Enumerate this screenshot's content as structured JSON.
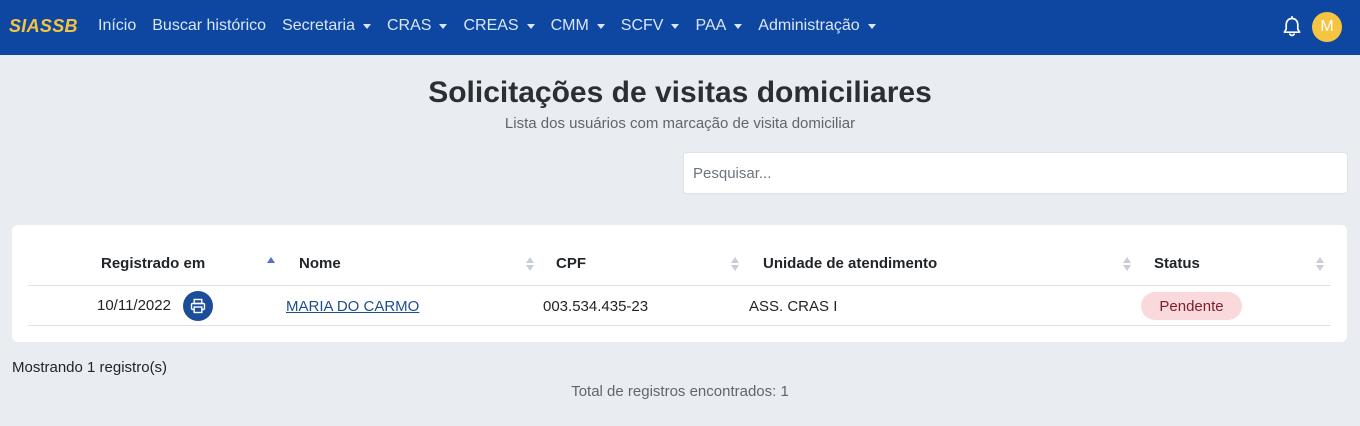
{
  "navbar": {
    "brand": "SIASSB",
    "items": [
      {
        "label": "Início",
        "dropdown": false
      },
      {
        "label": "Buscar histórico",
        "dropdown": false
      },
      {
        "label": "Secretaria",
        "dropdown": true
      },
      {
        "label": "CRAS",
        "dropdown": true
      },
      {
        "label": "CREAS",
        "dropdown": true
      },
      {
        "label": "CMM",
        "dropdown": true
      },
      {
        "label": "SCFV",
        "dropdown": true
      },
      {
        "label": "PAA",
        "dropdown": true
      },
      {
        "label": "Administração",
        "dropdown": true
      }
    ],
    "notification_icon": "bell-icon",
    "avatar_initial": "M",
    "colors": {
      "background": "#0d47a1",
      "brand": "#f5c542",
      "avatar": "#f5c542"
    }
  },
  "page": {
    "title": "Solicitações de visitas domiciliares",
    "subtitle": "Lista dos usuários com marcação de visita domiciliar"
  },
  "search": {
    "placeholder": "Pesquisar...",
    "value": ""
  },
  "table": {
    "columns": [
      {
        "label": "Registrado em",
        "sort": "ascending"
      },
      {
        "label": "Nome",
        "sort": "none"
      },
      {
        "label": "CPF",
        "sort": "none"
      },
      {
        "label": "Unidade de atendimento",
        "sort": "none"
      },
      {
        "label": "Status",
        "sort": "none"
      }
    ],
    "rows": [
      {
        "registrado_em": "10/11/2022",
        "action_icon": "printer-icon",
        "nome": "MARIA DO CARMO",
        "cpf": "003.534.435-23",
        "unidade": "ASS. CRAS I",
        "status": "Pendente",
        "status_color": "#f9d9dc"
      }
    ]
  },
  "footer": {
    "count_text": "Mostrando 1 registro(s)",
    "total_text": "Total de registros encontrados: 1"
  }
}
